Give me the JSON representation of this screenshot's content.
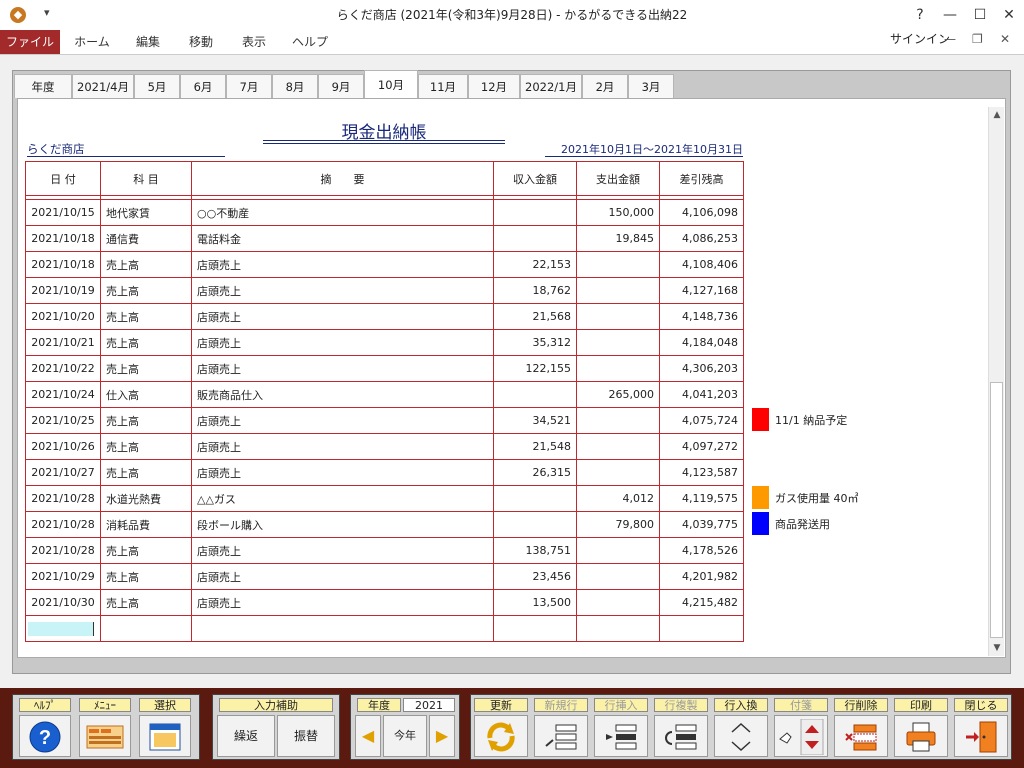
{
  "window": {
    "title": "らくだ商店 (2021年(令和3年)9月28日) - かるがるできる出納22",
    "help": "?",
    "minimize": "—",
    "maximize": "☐",
    "close": "✕"
  },
  "ribbon": {
    "tabs": [
      "ファイル",
      "ホーム",
      "編集",
      "移動",
      "表示",
      "ヘルプ"
    ],
    "signin": "サインイン"
  },
  "month_tabs": [
    "年度",
    "2021/4月",
    "5月",
    "6月",
    "7月",
    "8月",
    "9月",
    "10月",
    "11月",
    "12月",
    "2022/1月",
    "2月",
    "3月"
  ],
  "active_month": "10月",
  "ledger": {
    "title": "現金出納帳",
    "shop": "らくだ商店",
    "period": "2021年10月1日～2021年10月31日",
    "headers": [
      "日 付",
      "科 目",
      "摘　　要",
      "収入金額",
      "支出金額",
      "差引残高"
    ],
    "rows": [
      [
        "2021/10/15",
        "地代家賃",
        "○○不動産",
        "",
        "150,000",
        "4,106,098"
      ],
      [
        "2021/10/18",
        "通信費",
        "電話料金",
        "",
        "19,845",
        "4,086,253"
      ],
      [
        "2021/10/18",
        "売上高",
        "店頭売上",
        "22,153",
        "",
        "4,108,406"
      ],
      [
        "2021/10/19",
        "売上高",
        "店頭売上",
        "18,762",
        "",
        "4,127,168"
      ],
      [
        "2021/10/20",
        "売上高",
        "店頭売上",
        "21,568",
        "",
        "4,148,736"
      ],
      [
        "2021/10/21",
        "売上高",
        "店頭売上",
        "35,312",
        "",
        "4,184,048"
      ],
      [
        "2021/10/22",
        "売上高",
        "店頭売上",
        "122,155",
        "",
        "4,306,203"
      ],
      [
        "2021/10/24",
        "仕入高",
        "販売商品仕入",
        "",
        "265,000",
        "4,041,203"
      ],
      [
        "2021/10/25",
        "売上高",
        "店頭売上",
        "34,521",
        "",
        "4,075,724"
      ],
      [
        "2021/10/26",
        "売上高",
        "店頭売上",
        "21,548",
        "",
        "4,097,272"
      ],
      [
        "2021/10/27",
        "売上高",
        "店頭売上",
        "26,315",
        "",
        "4,123,587"
      ],
      [
        "2021/10/28",
        "水道光熱費",
        "△△ガス",
        "",
        "4,012",
        "4,119,575"
      ],
      [
        "2021/10/28",
        "消耗品費",
        "段ボール購入",
        "",
        "79,800",
        "4,039,775"
      ],
      [
        "2021/10/28",
        "売上高",
        "店頭売上",
        "138,751",
        "",
        "4,178,526"
      ],
      [
        "2021/10/29",
        "売上高",
        "店頭売上",
        "23,456",
        "",
        "4,201,982"
      ],
      [
        "2021/10/30",
        "売上高",
        "店頭売上",
        "13,500",
        "",
        "4,215,482"
      ]
    ]
  },
  "notes": [
    {
      "text": "11/1 納品予定",
      "color": "#ff0000",
      "row": 8
    },
    {
      "text": "ガス使用量 40㎥",
      "color": "#ff9900",
      "row": 11
    },
    {
      "text": "商品発送用",
      "color": "#0000ff",
      "row": 12
    }
  ],
  "toolbar": {
    "help": "ﾍﾙﾌﾟ",
    "menu": "ﾒﾆｭｰ",
    "select": "選択",
    "input_assist": "入力補助",
    "kurikaeshi": "繰返",
    "furikae": "振替",
    "year_label": "年度",
    "year_value": "2021",
    "this_year": "今年",
    "update": "更新",
    "new_row": "新規行",
    "insert_row": "行挿入",
    "copy_row": "行複製",
    "swap_row": "行入換",
    "sticky": "付箋",
    "delete_row": "行削除",
    "print": "印刷",
    "close": "閉じる"
  }
}
